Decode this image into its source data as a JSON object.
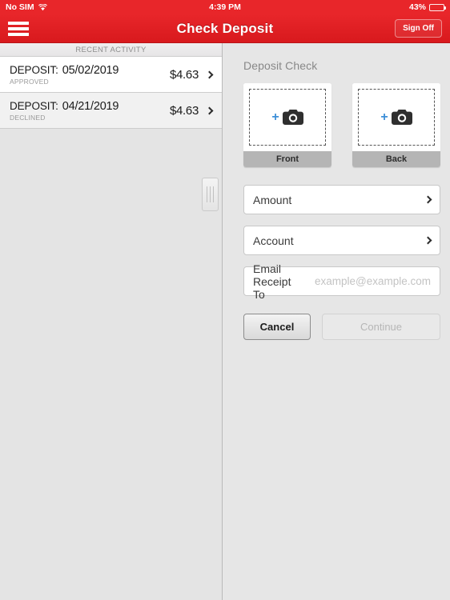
{
  "status_bar": {
    "carrier": "No SIM",
    "wifi_icon": "wifi-icon",
    "time": "4:39 PM",
    "battery_percent": "43%",
    "battery_level": 43
  },
  "nav_bar": {
    "menu_icon": "hamburger-menu-icon",
    "title": "Check Deposit",
    "sign_off_label": "Sign Off",
    "background_color": "#e8262a"
  },
  "left_panel": {
    "section_header": "RECENT ACTIVITY",
    "rows": [
      {
        "kind": "DEPOSIT:",
        "date": "05/02/2019",
        "status": "APPROVED",
        "amount": "$4.63",
        "chevron_icon": "chevron-right-icon"
      },
      {
        "kind": "DEPOSIT:",
        "date": "04/21/2019",
        "status": "DECLINED",
        "amount": "$4.63",
        "chevron_icon": "chevron-right-icon"
      }
    ]
  },
  "right_panel": {
    "title": "Deposit Check",
    "captures": [
      {
        "label": "Front",
        "plus_icon": "plus-icon",
        "camera_icon": "camera-icon"
      },
      {
        "label": "Back",
        "plus_icon": "plus-icon",
        "camera_icon": "camera-icon"
      }
    ],
    "fields": {
      "amount_label": "Amount",
      "account_label": "Account",
      "email_label": "Email Receipt To",
      "email_placeholder": "example@example.com"
    },
    "buttons": {
      "cancel_label": "Cancel",
      "continue_label": "Continue",
      "continue_disabled": true
    },
    "drag_handle_icon": "drag-handle-icon"
  },
  "colors": {
    "brand_red": "#e8262a",
    "accent_blue": "#3d8fd8",
    "panel_gray": "#e4e4e4"
  }
}
